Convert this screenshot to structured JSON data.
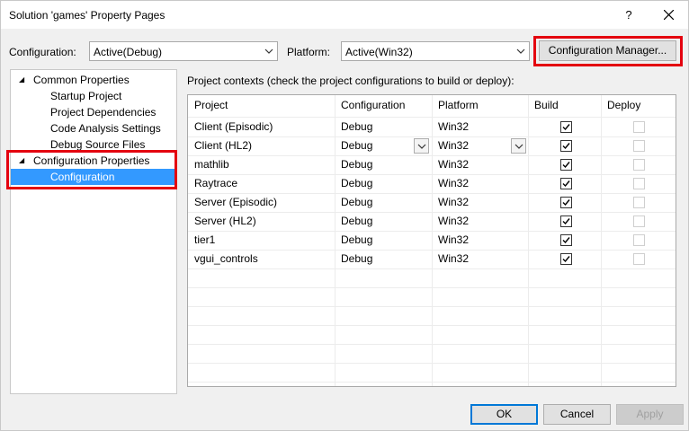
{
  "window": {
    "title": "Solution 'games' Property Pages",
    "help_label": "?"
  },
  "toolbar": {
    "configuration_label": "Configuration:",
    "configuration_value": "Active(Debug)",
    "platform_label": "Platform:",
    "platform_value": "Active(Win32)",
    "config_manager_label": "Configuration Manager..."
  },
  "tree": {
    "items": [
      {
        "label": "Common Properties",
        "level": 0,
        "expanded": true
      },
      {
        "label": "Startup Project",
        "level": 1
      },
      {
        "label": "Project Dependencies",
        "level": 1
      },
      {
        "label": "Code Analysis Settings",
        "level": 1
      },
      {
        "label": "Debug Source Files",
        "level": 1
      },
      {
        "label": "Configuration Properties",
        "level": 0,
        "expanded": true
      },
      {
        "label": "Configuration",
        "level": 1,
        "selected": true
      }
    ]
  },
  "grid": {
    "caption": "Project contexts (check the project configurations to build or deploy):",
    "columns": [
      "Project",
      "Configuration",
      "Platform",
      "Build",
      "Deploy"
    ],
    "rows": [
      {
        "project": "Client (Episodic)",
        "configuration": "Debug",
        "platform": "Win32",
        "build": true,
        "deploy": false
      },
      {
        "project": "Client (HL2)",
        "configuration": "Debug",
        "platform": "Win32",
        "build": true,
        "deploy": false
      },
      {
        "project": "mathlib",
        "configuration": "Debug",
        "platform": "Win32",
        "build": true,
        "deploy": false
      },
      {
        "project": "Raytrace",
        "configuration": "Debug",
        "platform": "Win32",
        "build": true,
        "deploy": false
      },
      {
        "project": "Server (Episodic)",
        "configuration": "Debug",
        "platform": "Win32",
        "build": true,
        "deploy": false
      },
      {
        "project": "Server (HL2)",
        "configuration": "Debug",
        "platform": "Win32",
        "build": true,
        "deploy": false
      },
      {
        "project": "tier1",
        "configuration": "Debug",
        "platform": "Win32",
        "build": true,
        "deploy": false
      },
      {
        "project": "vgui_controls",
        "configuration": "Debug",
        "platform": "Win32",
        "build": true,
        "deploy": false
      }
    ]
  },
  "buttons": {
    "ok": "OK",
    "cancel": "Cancel",
    "apply": "Apply"
  },
  "colors": {
    "highlight": "#e4000f",
    "selection": "#3399ff"
  }
}
